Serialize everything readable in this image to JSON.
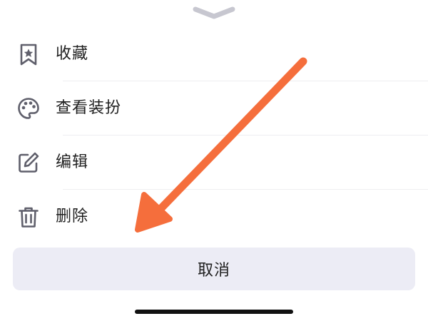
{
  "sheet": {
    "handle_icon": "chevron-down-icon",
    "items": [
      {
        "id": "favorite",
        "icon": "bookmark-star-icon",
        "label": "收藏"
      },
      {
        "id": "outfit",
        "icon": "palette-icon",
        "label": "查看装扮"
      },
      {
        "id": "edit",
        "icon": "edit-icon",
        "label": "编辑"
      },
      {
        "id": "delete",
        "icon": "trash-icon",
        "label": "删除"
      }
    ],
    "cancel_label": "取消"
  },
  "annotation": {
    "arrow_color": "#F56E3C",
    "arrow_icon": "pointer-arrow"
  },
  "colors": {
    "icon": "#5f5f6b",
    "text": "#1f1f1f",
    "cancel_bg": "#ececf5",
    "divider": "#eeeef1"
  }
}
